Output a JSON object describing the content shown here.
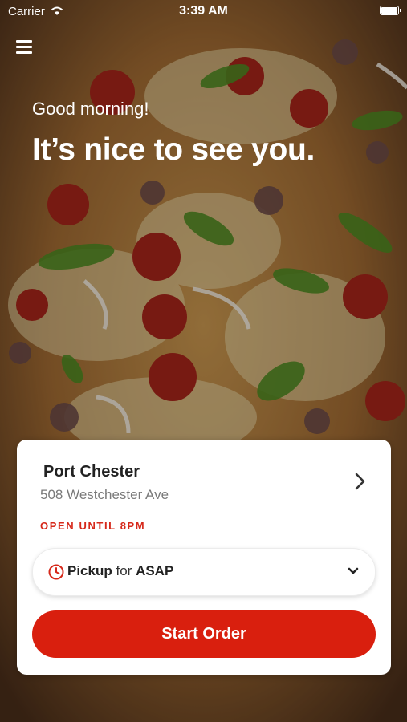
{
  "status_bar": {
    "carrier": "Carrier",
    "time": "3:39 AM"
  },
  "header": {
    "menu_icon": "hamburger-menu-icon",
    "greeting": "Good morning!",
    "headline": "It’s nice to see you."
  },
  "location_card": {
    "name": "Port Chester",
    "address": "508 Westchester Ave",
    "hours_status": "OPEN UNTIL 8PM",
    "pickup": {
      "method": "Pickup",
      "connector": "for",
      "time": "ASAP"
    },
    "start_order_label": "Start Order"
  },
  "colors": {
    "accent": "#d91f0e",
    "hours_text": "#d6281a",
    "card_background": "#ffffff"
  },
  "background": "pizza-photo"
}
